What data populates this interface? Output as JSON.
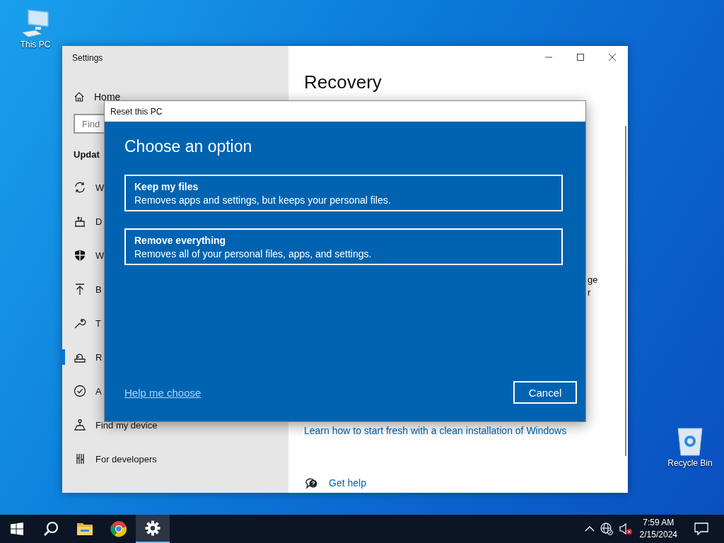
{
  "desktop_icons": [
    {
      "label": "This PC",
      "kind": "computer"
    },
    {
      "label": "Recycle Bin",
      "kind": "bin"
    }
  ],
  "settings_window": {
    "title": "Settings",
    "home": "Home",
    "search": {
      "placeholder": "Find"
    },
    "section": "Updat",
    "items": [
      {
        "label": "W",
        "kind": "sync",
        "selected": false
      },
      {
        "label": "D",
        "kind": "delivery",
        "selected": false
      },
      {
        "label": "W",
        "kind": "shield",
        "selected": false
      },
      {
        "label": "B",
        "kind": "backup",
        "selected": false
      },
      {
        "label": "T",
        "kind": "wrench",
        "selected": false
      },
      {
        "label": "R",
        "kind": "recovery",
        "selected": true
      },
      {
        "label": "A",
        "kind": "activation",
        "selected": false
      },
      {
        "label": "Find my device",
        "kind": "find",
        "selected": false
      },
      {
        "label": "For developers",
        "kind": "developers",
        "selected": false
      }
    ],
    "page_title": "Recovery",
    "fragments": [
      "ge",
      "r"
    ],
    "link": "Learn how to start fresh with a clean installation of Windows",
    "help": "Get help"
  },
  "dialog": {
    "title": "Reset this PC",
    "heading": "Choose an option",
    "options": [
      {
        "title": "Keep my files",
        "description": "Removes apps and settings, but keeps your personal files."
      },
      {
        "title": "Remove everything",
        "description": "Removes all of your personal files, apps, and settings."
      }
    ],
    "help_link": "Help me choose",
    "cancel": "Cancel"
  },
  "taskbar": {
    "apps": [
      {
        "kind": "search",
        "selected": false
      },
      {
        "kind": "folder",
        "selected": false
      },
      {
        "kind": "browser",
        "selected": false
      },
      {
        "kind": "gear",
        "selected": true
      }
    ],
    "time": "7:59 AM",
    "date": "2/15/2024"
  }
}
